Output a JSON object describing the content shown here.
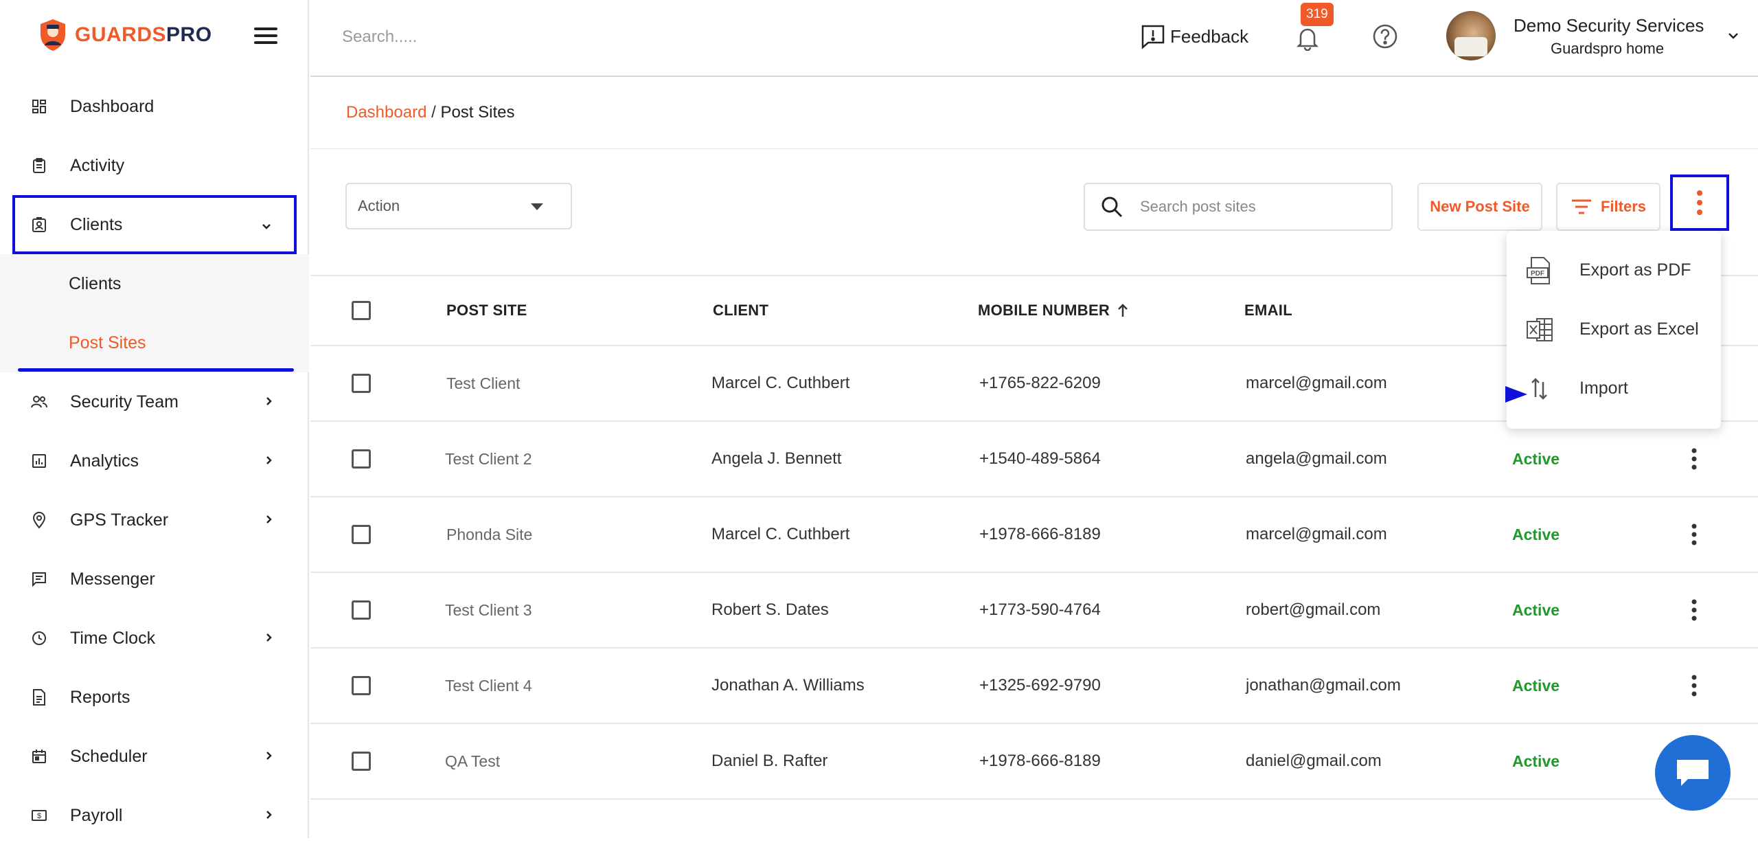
{
  "app": {
    "logo_part1": "GUARDS",
    "logo_part2": "PRO"
  },
  "sidebar": {
    "items": [
      {
        "label": "Dashboard"
      },
      {
        "label": "Activity"
      },
      {
        "label": "Clients"
      },
      {
        "label": "Security Team"
      },
      {
        "label": "Analytics"
      },
      {
        "label": "GPS Tracker"
      },
      {
        "label": "Messenger"
      },
      {
        "label": "Time Clock"
      },
      {
        "label": "Reports"
      },
      {
        "label": "Scheduler"
      },
      {
        "label": "Payroll"
      }
    ],
    "clients_sub": [
      {
        "label": "Clients"
      },
      {
        "label": "Post Sites"
      }
    ]
  },
  "header": {
    "search_placeholder": "Search.....",
    "feedback_label": "Feedback",
    "notification_count": "319",
    "org_name": "Demo Security Services",
    "org_sub": "Guardspro home"
  },
  "breadcrumb": {
    "root": "Dashboard",
    "separator": "/",
    "current": "Post Sites"
  },
  "toolbar": {
    "action_label": "Action",
    "search_placeholder": "Search post sites",
    "new_button": "New Post Site",
    "filters_button": "Filters"
  },
  "dropdown": {
    "items": [
      {
        "label": "Export as PDF"
      },
      {
        "label": "Export as Excel"
      },
      {
        "label": "Import"
      }
    ]
  },
  "table": {
    "headers": {
      "post_site": "POST SITE",
      "client": "CLIENT",
      "mobile": "MOBILE NUMBER",
      "email": "EMAIL"
    },
    "rows": [
      {
        "post_site": "Test Client",
        "client": "Marcel C. Cuthbert",
        "mobile": "+1765-822-6209",
        "email": "marcel@gmail.com",
        "status": ""
      },
      {
        "post_site": "Test Client 2",
        "client": "Angela J. Bennett",
        "mobile": "+1540-489-5864",
        "email": "angela@gmail.com",
        "status": "Active"
      },
      {
        "post_site": "Phonda Site",
        "client": "Marcel C. Cuthbert",
        "mobile": "+1978-666-8189",
        "email": "marcel@gmail.com",
        "status": "Active"
      },
      {
        "post_site": "Test Client 3",
        "client": "Robert S. Dates",
        "mobile": "+1773-590-4764",
        "email": "robert@gmail.com",
        "status": "Active"
      },
      {
        "post_site": "Test Client 4",
        "client": "Jonathan A. Williams",
        "mobile": "+1325-692-9790",
        "email": "jonathan@gmail.com",
        "status": "Active"
      },
      {
        "post_site": "QA Test",
        "client": "Daniel B. Rafter",
        "mobile": "+1978-666-8189",
        "email": "daniel@gmail.com",
        "status": "Active"
      }
    ]
  },
  "colors": {
    "brand": "#f05a28",
    "highlight": "#1010d8",
    "active": "#1e9a2a",
    "chat": "#1f6fd6"
  }
}
